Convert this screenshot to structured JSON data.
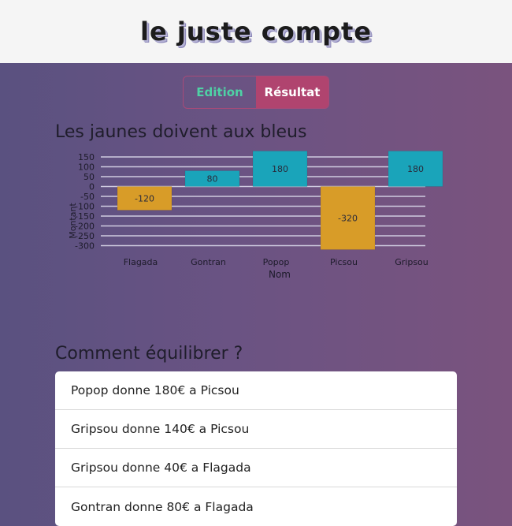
{
  "app": {
    "title": "le juste compte"
  },
  "tabs": [
    {
      "label": "Edition"
    },
    {
      "label": "Résultat"
    }
  ],
  "chart_section": {
    "title": "Les jaunes doivent aux bleus"
  },
  "chart_data": {
    "type": "bar",
    "categories": [
      "Flagada",
      "Gontran",
      "Popop",
      "Picsou",
      "Gripsou"
    ],
    "values": [
      -120,
      80,
      180,
      -320,
      180
    ],
    "title": "",
    "xlabel": "Nom",
    "ylabel": "Montant",
    "yticks": [
      150,
      100,
      50,
      0,
      -50,
      -100,
      -150,
      -200,
      -250,
      -300
    ],
    "colors": {
      "positive": "#1aa4ba",
      "negative": "#d89c28"
    }
  },
  "balance_section": {
    "title": "Comment équilibrer ?",
    "items": [
      "Popop donne 180€ a Picsou",
      "Gripsou donne 140€ a Picsou",
      "Gripsou donne 40€ a Flagada",
      "Gontran donne 80€ a Flagada"
    ]
  }
}
